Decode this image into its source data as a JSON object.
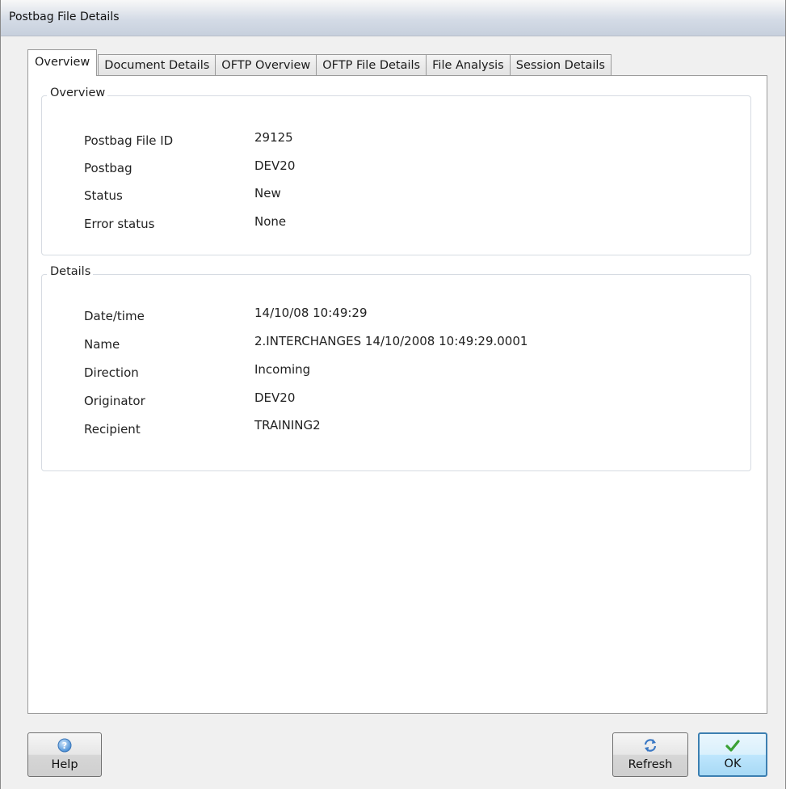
{
  "window": {
    "title": "Postbag File Details"
  },
  "tabs": [
    {
      "label": "Overview",
      "active": true
    },
    {
      "label": "Document Details",
      "active": false
    },
    {
      "label": "OFTP Overview",
      "active": false
    },
    {
      "label": "OFTP File Details",
      "active": false
    },
    {
      "label": "File Analysis",
      "active": false
    },
    {
      "label": "Session Details",
      "active": false
    }
  ],
  "overview": {
    "legend": "Overview",
    "fields": [
      {
        "label": "Postbag File ID",
        "value": "29125"
      },
      {
        "label": "Postbag",
        "value": "DEV20"
      },
      {
        "label": "Status",
        "value": "New"
      },
      {
        "label": "Error status",
        "value": "None"
      }
    ]
  },
  "details": {
    "legend": "Details",
    "fields": [
      {
        "label": "Date/time",
        "value": "14/10/08 10:49:29"
      },
      {
        "label": "Name",
        "value": "2.INTERCHANGES 14/10/2008 10:49:29.0001"
      },
      {
        "label": "Direction",
        "value": "Incoming"
      },
      {
        "label": "Originator",
        "value": "DEV20"
      },
      {
        "label": "Recipient",
        "value": "TRAINING2"
      }
    ]
  },
  "buttons": {
    "help": {
      "label": "Help",
      "icon": "help-icon"
    },
    "refresh": {
      "label": "Refresh",
      "icon": "refresh-icon"
    },
    "ok": {
      "label": "OK",
      "icon": "checkmark-icon"
    }
  },
  "colors": {
    "accent": "#3c7fb1",
    "ok_check": "#3aa135",
    "help_icon": "#4a8fd6"
  }
}
